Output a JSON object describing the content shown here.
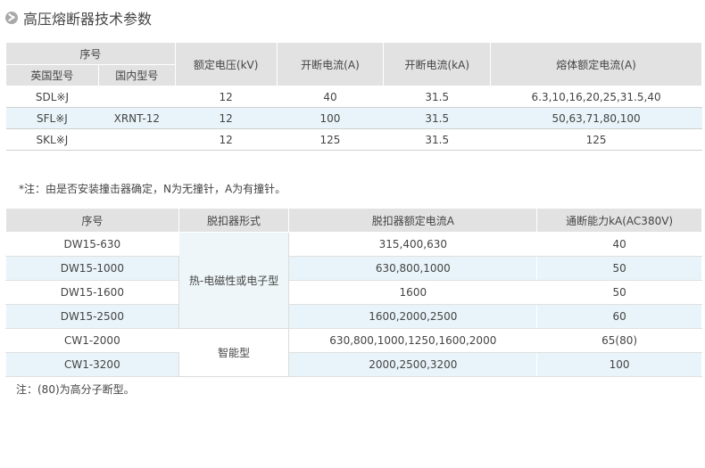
{
  "title": "高压熔断器技术参数",
  "table1": {
    "header_group": "序号",
    "headers": {
      "british_model": "英国型号",
      "domestic_model": "国内型号",
      "rated_voltage": "额定电压(kV)",
      "breaking_current_a": "开断电流(A)",
      "breaking_current_ka": "开断电流(kA)",
      "fuse_rated_current": "熔体额定电流(A)"
    },
    "rows": [
      {
        "british": "SDL※J",
        "domestic": "",
        "voltage": "12",
        "break_a": "40",
        "break_ka": "31.5",
        "fuse": "6.3,10,16,20,25,31.5,40"
      },
      {
        "british": "SFL※J",
        "domestic": "XRNT-12",
        "voltage": "12",
        "break_a": "100",
        "break_ka": "31.5",
        "fuse": "50,63,71,80,100"
      },
      {
        "british": "SKL※J",
        "domestic": "",
        "voltage": "12",
        "break_a": "125",
        "break_ka": "31.5",
        "fuse": "125"
      }
    ]
  },
  "note1": "*注：由是否安装撞击器确定，N为无撞针，A为有撞针。",
  "table2": {
    "headers": {
      "seq": "序号",
      "release_type": "脱扣器形式",
      "rated_current": "脱扣器额定电流A",
      "breaking_capacity": "通断能力kA(AC380V)"
    },
    "merged_type_1": "热-电磁性或电子型",
    "merged_type_2": "智能型",
    "rows": [
      {
        "seq": "DW15-630",
        "current": "315,400,630",
        "capacity": "40"
      },
      {
        "seq": "DW15-1000",
        "current": "630,800,1000",
        "capacity": "50"
      },
      {
        "seq": "DW15-1600",
        "current": "1600",
        "capacity": "50"
      },
      {
        "seq": "DW15-2500",
        "current": "1600,2000,2500",
        "capacity": "60"
      },
      {
        "seq": "CW1-2000",
        "current": "630,800,1000,1250,1600,2000",
        "capacity": "65(80)"
      },
      {
        "seq": "CW1-3200",
        "current": "2000,2500,3200",
        "capacity": "100"
      }
    ]
  },
  "note2": "注：(80)为高分子断型。",
  "colors": {
    "header_bg": "#e2e2e2",
    "alt_row_bg": "#e8f4f9"
  }
}
